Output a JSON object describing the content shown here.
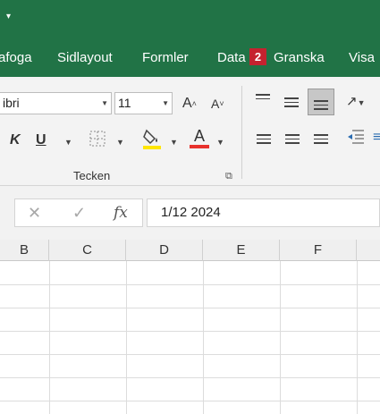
{
  "titlebar": {
    "qat_arrow": "▾"
  },
  "tabs": [
    {
      "label": "afoga"
    },
    {
      "label": "Sidlayout"
    },
    {
      "label": "Formler"
    },
    {
      "label": "Data"
    },
    {
      "label": "Granska"
    },
    {
      "label": "Visa"
    }
  ],
  "tab_badge": "2",
  "ribbon": {
    "font_name": "ibri",
    "font_size": "11",
    "increase_font": "A",
    "decrease_font": "A",
    "bold_label": "K",
    "underline_label": "U",
    "font_color_label": "A",
    "group_label": "Tecken",
    "font_color_hex": "#e8322d",
    "highlight_color_hex": "#ffe600"
  },
  "formula_bar": {
    "cancel_icon": "✕",
    "enter_icon": "✓",
    "fx_label": "fx",
    "value": "1/12 2024"
  },
  "columns": [
    "B",
    "C",
    "D",
    "E",
    "F"
  ],
  "colors": {
    "excel_green": "#217346"
  }
}
